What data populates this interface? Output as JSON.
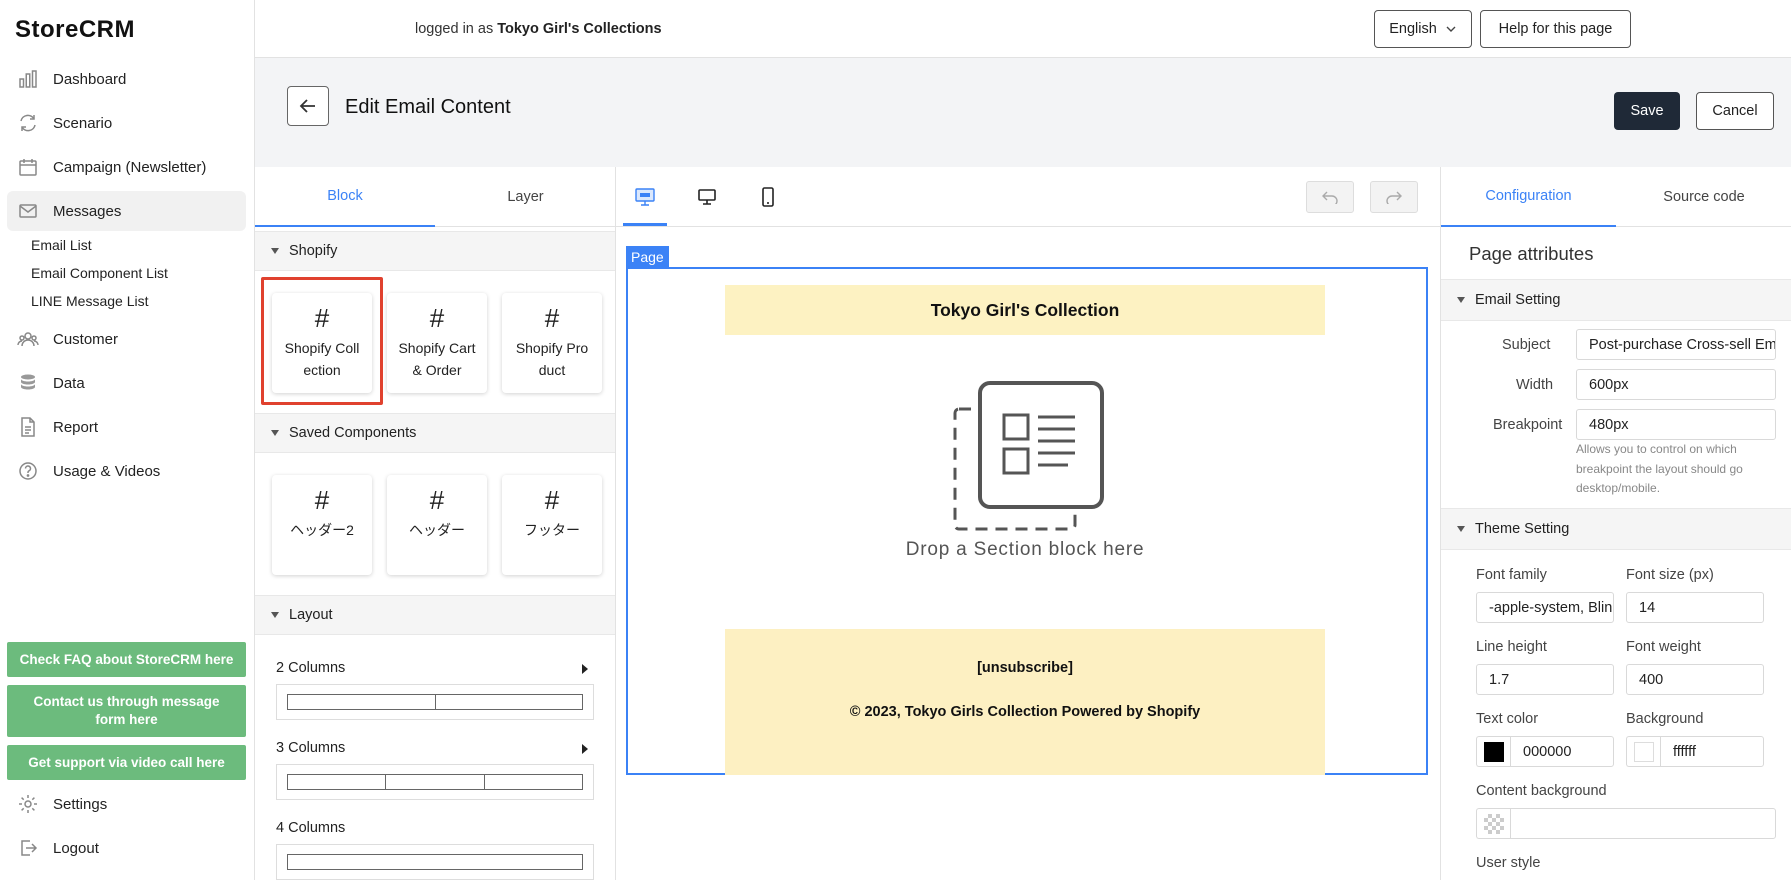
{
  "app": {
    "name": "StoreCRM"
  },
  "sidebar": {
    "items": [
      {
        "label": "Dashboard",
        "icon": "bar-chart-icon"
      },
      {
        "label": "Scenario",
        "icon": "refresh-icon"
      },
      {
        "label": "Campaign (Newsletter)",
        "icon": "calendar-icon"
      },
      {
        "label": "Messages",
        "icon": "envelope-icon"
      },
      {
        "label": "Customer",
        "icon": "users-icon"
      },
      {
        "label": "Data",
        "icon": "database-icon"
      },
      {
        "label": "Report",
        "icon": "document-icon"
      },
      {
        "label": "Usage & Videos",
        "icon": "help-circle-icon"
      }
    ],
    "sub_items": [
      "Email List",
      "Email Component List",
      "LINE Message List"
    ],
    "help_buttons": [
      "Check FAQ about StoreCRM here",
      "Contact us through message form here",
      "Get support via video call here"
    ],
    "bottom_items": [
      {
        "label": "Settings",
        "icon": "gear-icon"
      },
      {
        "label": "Logout",
        "icon": "logout-icon"
      }
    ]
  },
  "topbar": {
    "login_prefix": "logged in as",
    "shop_name": "Tokyo Girl's Collections",
    "language": "English",
    "help_label": "Help for this page"
  },
  "header": {
    "title": "Edit Email Content",
    "save_label": "Save",
    "cancel_label": "Cancel"
  },
  "left_panel": {
    "tabs": [
      "Block",
      "Layer"
    ],
    "sections": {
      "shopify": {
        "title": "Shopify",
        "blocks": [
          "Shopify Collection",
          "Shopify Cart & Order",
          "Shopify Product"
        ]
      },
      "saved": {
        "title": "Saved Components",
        "blocks": [
          "ヘッダー2",
          "ヘッダー",
          "フッター"
        ]
      },
      "layout": {
        "title": "Layout",
        "rows": [
          "2 Columns",
          "3 Columns",
          "4 Columns"
        ]
      }
    }
  },
  "canvas": {
    "page_tag": "Page",
    "header_text": "Tokyo Girl's Collection",
    "drop_text": "Drop a Section block here",
    "unsubscribe": "[unsubscribe]",
    "copyright": "© 2023, Tokyo Girls Collection Powered by Shopify"
  },
  "right_panel": {
    "tabs": [
      "Configuration",
      "Source code"
    ],
    "page_attributes": "Page attributes",
    "email_setting": {
      "title": "Email Setting",
      "subject_label": "Subject",
      "subject_value": "Post-purchase Cross-sell Email",
      "width_label": "Width",
      "width_value": "600px",
      "breakpoint_label": "Breakpoint",
      "breakpoint_value": "480px",
      "breakpoint_hint": "Allows you to control on which breakpoint the layout should go desktop/mobile."
    },
    "theme_setting": {
      "title": "Theme Setting",
      "font_family_label": "Font family",
      "font_family_value": "-apple-system, BlinkMacSystemFont",
      "font_size_label": "Font size (px)",
      "font_size_value": "14",
      "line_height_label": "Line height",
      "line_height_value": "1.7",
      "font_weight_label": "Font weight",
      "font_weight_value": "400",
      "text_color_label": "Text color",
      "text_color_value": "000000",
      "background_label": "Background",
      "background_value": "ffffff",
      "content_bg_label": "Content background",
      "content_bg_value": "",
      "user_style_label": "User style"
    }
  },
  "colors": {
    "accent": "#3b82f6",
    "save_bg": "#1f2937",
    "help_green": "#6cbb7d",
    "highlight_red": "#e0412e",
    "band_yellow": "#fdf2c2"
  }
}
